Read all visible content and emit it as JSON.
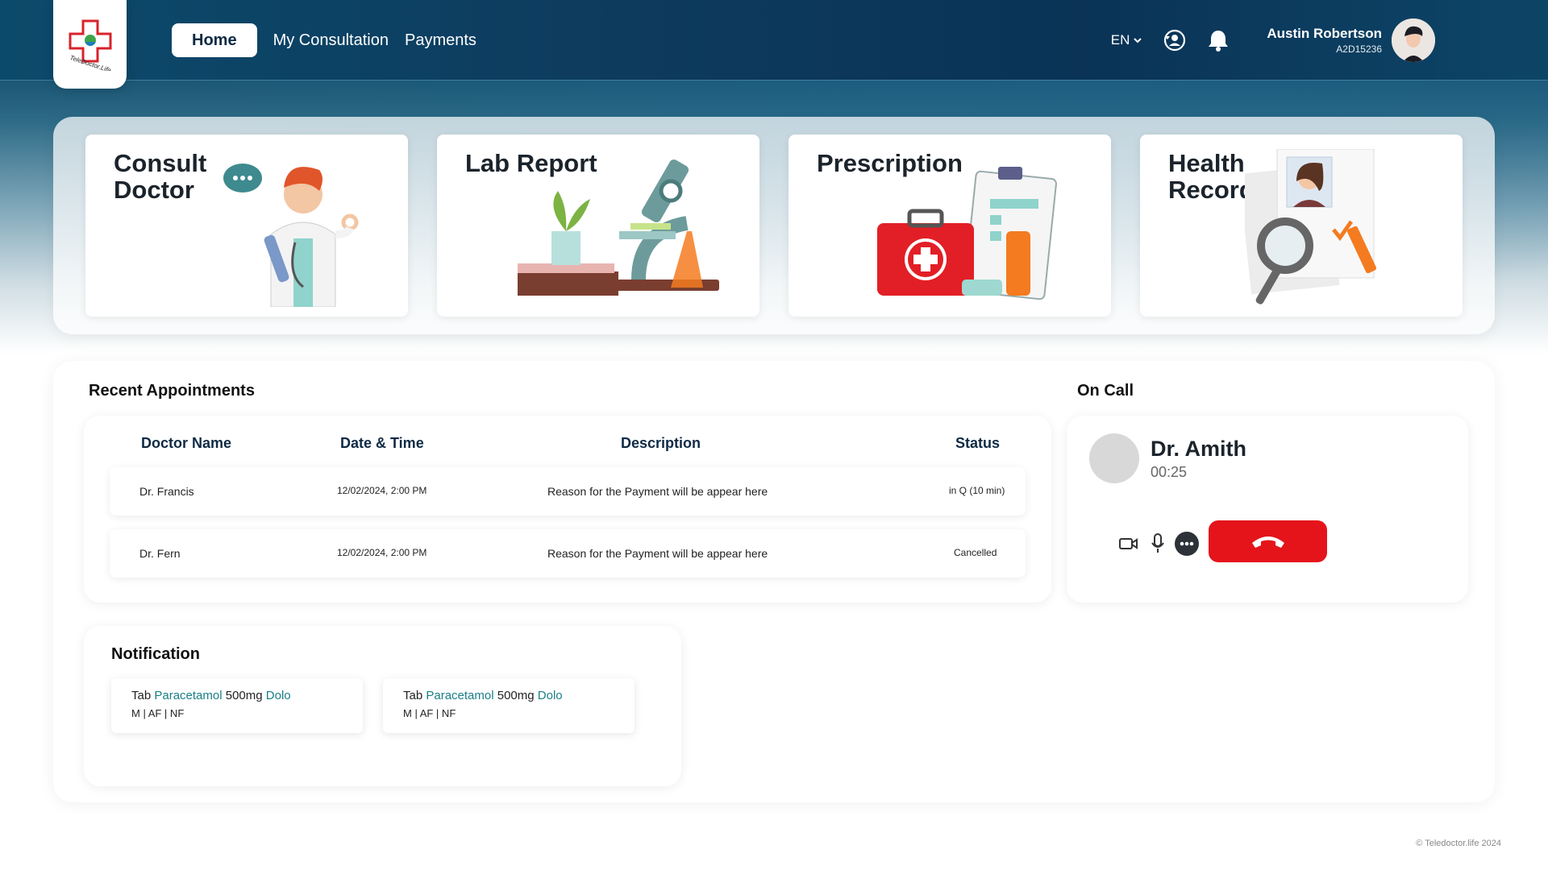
{
  "app": {
    "logo_text": "TeleDoctor.Life",
    "footer": "© Teledoctor.life 2024"
  },
  "nav": {
    "items": [
      {
        "label": "Home",
        "active": true
      },
      {
        "label": "My Consultation",
        "active": false
      },
      {
        "label": "Payments",
        "active": false
      }
    ]
  },
  "header": {
    "language": "EN",
    "icons": [
      "account-switch-icon",
      "bell-icon",
      "chevron-down-icon"
    ],
    "user": {
      "name": "Austin Robertson",
      "id": "A2D15236"
    }
  },
  "cards": [
    {
      "title": "Consult Doctor",
      "icon": "doctor-illustration"
    },
    {
      "title": "Lab Report",
      "icon": "microscope-illustration"
    },
    {
      "title": "Prescription",
      "icon": "first-aid-illustration"
    },
    {
      "title": "Health Records",
      "icon": "records-illustration"
    }
  ],
  "appointments": {
    "title": "Recent Appointments",
    "columns": [
      "Doctor Name",
      "Date & Time",
      "Description",
      "Status"
    ],
    "rows": [
      {
        "doctor": "Dr. Francis",
        "datetime": "12/02/2024, 2:00 PM",
        "description": "Reason for the Payment will be appear here",
        "status": "in Q (10 min)"
      },
      {
        "doctor": "Dr. Fern",
        "datetime": "12/02/2024, 2:00 PM",
        "description": "Reason for the Payment will be appear here",
        "status": "Cancelled"
      }
    ]
  },
  "on_call": {
    "title": "On Call",
    "doctor": "Dr. Amith",
    "duration": "00:25",
    "controls": [
      "video-camera-icon",
      "microphone-icon",
      "more-options-icon",
      "end-call-icon"
    ],
    "end_color": "#e5141b"
  },
  "notifications": {
    "title": "Notification",
    "items": [
      {
        "prefix": "Tab",
        "drug": "Paracetamol",
        "dose": "500mg",
        "brand": "Dolo",
        "schedule": "M | AF | NF"
      },
      {
        "prefix": "Tab",
        "drug": "Paracetamol",
        "dose": "500mg",
        "brand": "Dolo",
        "schedule": "M | AF | NF"
      }
    ]
  },
  "colors": {
    "header_bg": "#0d3b5e",
    "accent_link": "#1a7f86",
    "danger": "#e5141b"
  }
}
